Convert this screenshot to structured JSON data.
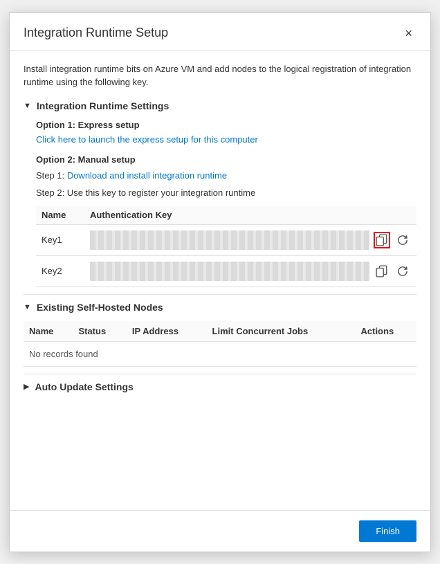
{
  "dialog": {
    "title": "Integration Runtime Setup",
    "close_label": "×"
  },
  "intro": {
    "text": "Install integration runtime bits on Azure VM and add nodes to the logical registration of integration runtime using the following key."
  },
  "section_integration": {
    "triangle": "▼",
    "title": "Integration Runtime Settings",
    "option1": {
      "title": "Option 1: Express setup",
      "link_text": "Click here to launch the express setup for this computer"
    },
    "option2": {
      "title": "Option 2: Manual setup",
      "step1_prefix": "Step 1: ",
      "step1_link": "Download and install integration runtime",
      "step2_text": "Step 2: Use this key to register your integration runtime"
    },
    "keys_table": {
      "col_name": "Name",
      "col_auth_key": "Authentication Key",
      "rows": [
        {
          "name": "Key1",
          "masked": true,
          "highlighted": true
        },
        {
          "name": "Key2",
          "masked": true,
          "highlighted": false
        }
      ]
    }
  },
  "section_nodes": {
    "triangle": "▼",
    "title": "Existing Self-Hosted Nodes",
    "columns": [
      "Name",
      "Status",
      "IP Address",
      "Limit Concurrent Jobs",
      "Actions"
    ],
    "no_records": "No records found"
  },
  "section_auto_update": {
    "triangle": "▶",
    "title": "Auto Update Settings"
  },
  "footer": {
    "finish_label": "Finish"
  }
}
